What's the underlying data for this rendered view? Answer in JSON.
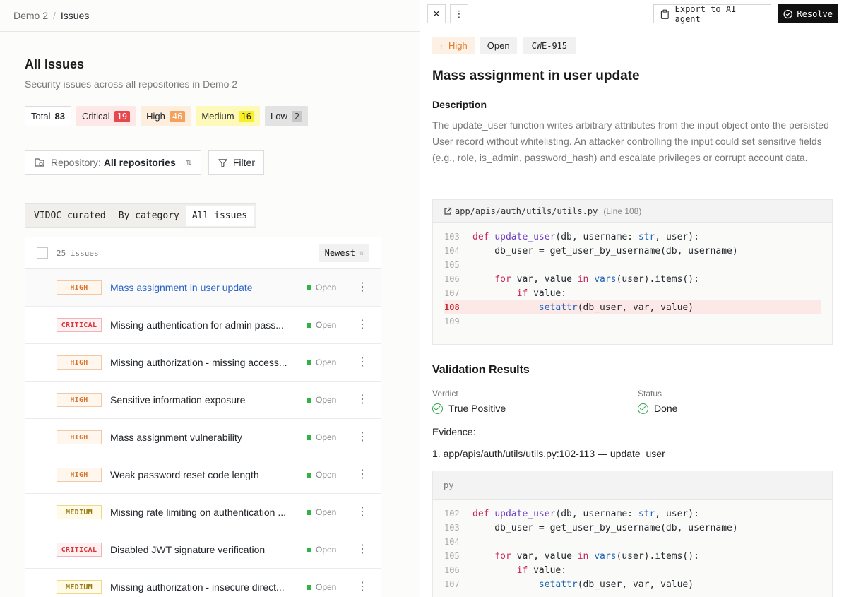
{
  "breadcrumb": {
    "project": "Demo 2",
    "separator": "/",
    "current": "Issues"
  },
  "page": {
    "title": "All Issues",
    "subtitle": "Security issues across all repositories in Demo 2"
  },
  "counts": {
    "total_label": "Total",
    "total": "83",
    "critical_label": "Critical",
    "critical": "19",
    "high_label": "High",
    "high": "46",
    "medium_label": "Medium",
    "medium": "16",
    "low_label": "Low",
    "low": "2"
  },
  "filters": {
    "repo_label": "Repository:",
    "repo_value": "All repositories",
    "filter_label": "Filter"
  },
  "view_tabs": [
    "VIDOC curated",
    "By category",
    "All issues"
  ],
  "list": {
    "count_label": "25 issues",
    "sort_label": "Newest"
  },
  "issues": [
    {
      "severity": "HIGH",
      "title": "Mass assignment in user update",
      "status": "Open"
    },
    {
      "severity": "CRITICAL",
      "title": "Missing authentication for admin pass...",
      "status": "Open"
    },
    {
      "severity": "HIGH",
      "title": "Missing authorization - missing access...",
      "status": "Open"
    },
    {
      "severity": "HIGH",
      "title": "Sensitive information exposure",
      "status": "Open"
    },
    {
      "severity": "HIGH",
      "title": "Mass assignment vulnerability",
      "status": "Open"
    },
    {
      "severity": "HIGH",
      "title": "Weak password reset code length",
      "status": "Open"
    },
    {
      "severity": "MEDIUM",
      "title": "Missing rate limiting on authentication ...",
      "status": "Open"
    },
    {
      "severity": "CRITICAL",
      "title": "Disabled JWT signature verification",
      "status": "Open"
    },
    {
      "severity": "MEDIUM",
      "title": "Missing authorization - insecure direct...",
      "status": "Open"
    }
  ],
  "detail": {
    "export_label": "Export to AI agent",
    "resolve_label": "Resolve",
    "tags": {
      "severity": "High",
      "status": "Open",
      "cwe": "CWE-915"
    },
    "title": "Mass assignment in user update",
    "description_heading": "Description",
    "description": "The update_user function writes arbitrary attributes from the input object onto the persisted User record without whitelisting. An attacker controlling the input could set sensitive fields (e.g., role, is_admin, password_hash) and escalate privileges or corrupt account data.",
    "code1": {
      "path": "app/apis/auth/utils/utils.py",
      "line_note": "(Line 108)",
      "lines": [
        "103",
        "104",
        "105",
        "106",
        "107",
        "108",
        "109"
      ]
    },
    "validation_heading": "Validation Results",
    "verdict_label": "Verdict",
    "verdict_value": "True Positive",
    "status_label": "Status",
    "status_value": "Done",
    "evidence_heading": "Evidence:",
    "evidence_1": "1. app/apis/auth/utils/utils.py:102-113 — update_user",
    "code2": {
      "lang": "py",
      "lines": [
        "102",
        "103",
        "104",
        "105",
        "106",
        "107"
      ]
    }
  },
  "colors": {
    "accent_link": "#2b63c6",
    "critical": "#e5484d",
    "high": "#f4a15d",
    "medium": "#f9ef26",
    "open": "#2fb344",
    "resolve_bg": "#111111"
  }
}
